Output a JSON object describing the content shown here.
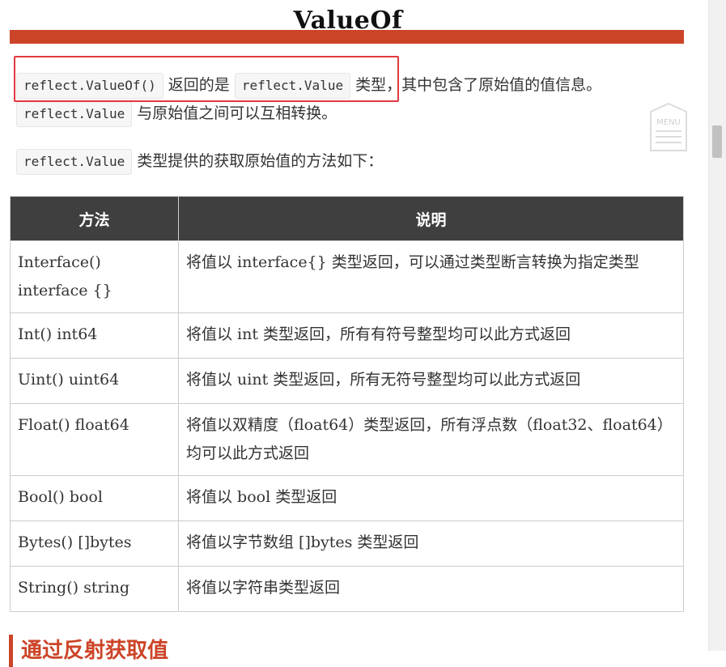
{
  "article": {
    "heading": "ValueOf",
    "para1": {
      "code1": "reflect.ValueOf()",
      "text1": " 返回的是 ",
      "code2": "reflect.Value",
      "text2": " 类型，其中包含了原始值的值信息。",
      "code3": "reflect.Value",
      "text3": " 与原始值之间可以互相转换。"
    },
    "para2": {
      "code": "reflect.Value",
      "text": " 类型提供的获取原始值的方法如下："
    },
    "next_heading": "通过反射获取值"
  },
  "table": {
    "headers": [
      "方法",
      "说明"
    ],
    "rows": [
      {
        "method": "Interface() interface {}",
        "desc": "将值以 interface{} 类型返回，可以通过类型断言转换为指定类型"
      },
      {
        "method": "Int() int64",
        "desc": "将值以 int 类型返回，所有有符号整型均可以此方式返回"
      },
      {
        "method": "Uint() uint64",
        "desc": "将值以 uint 类型返回，所有无符号整型均可以此方式返回"
      },
      {
        "method": "Float() float64",
        "desc": "将值以双精度（float64）类型返回，所有浮点数（float32、float64）均可以此方式返回"
      },
      {
        "method": "Bool() bool",
        "desc": "将值以 bool 类型返回"
      },
      {
        "method": "Bytes() []bytes",
        "desc": "将值以字节数组 []bytes 类型返回"
      },
      {
        "method": "String() string",
        "desc": "将值以字符串类型返回"
      }
    ]
  },
  "menu_button": {
    "label": "MENU",
    "icon": "menu-icon"
  },
  "colors": {
    "accent": "#cc4428",
    "highlight": "#e2383f",
    "table_header": "#3f3f3f"
  }
}
